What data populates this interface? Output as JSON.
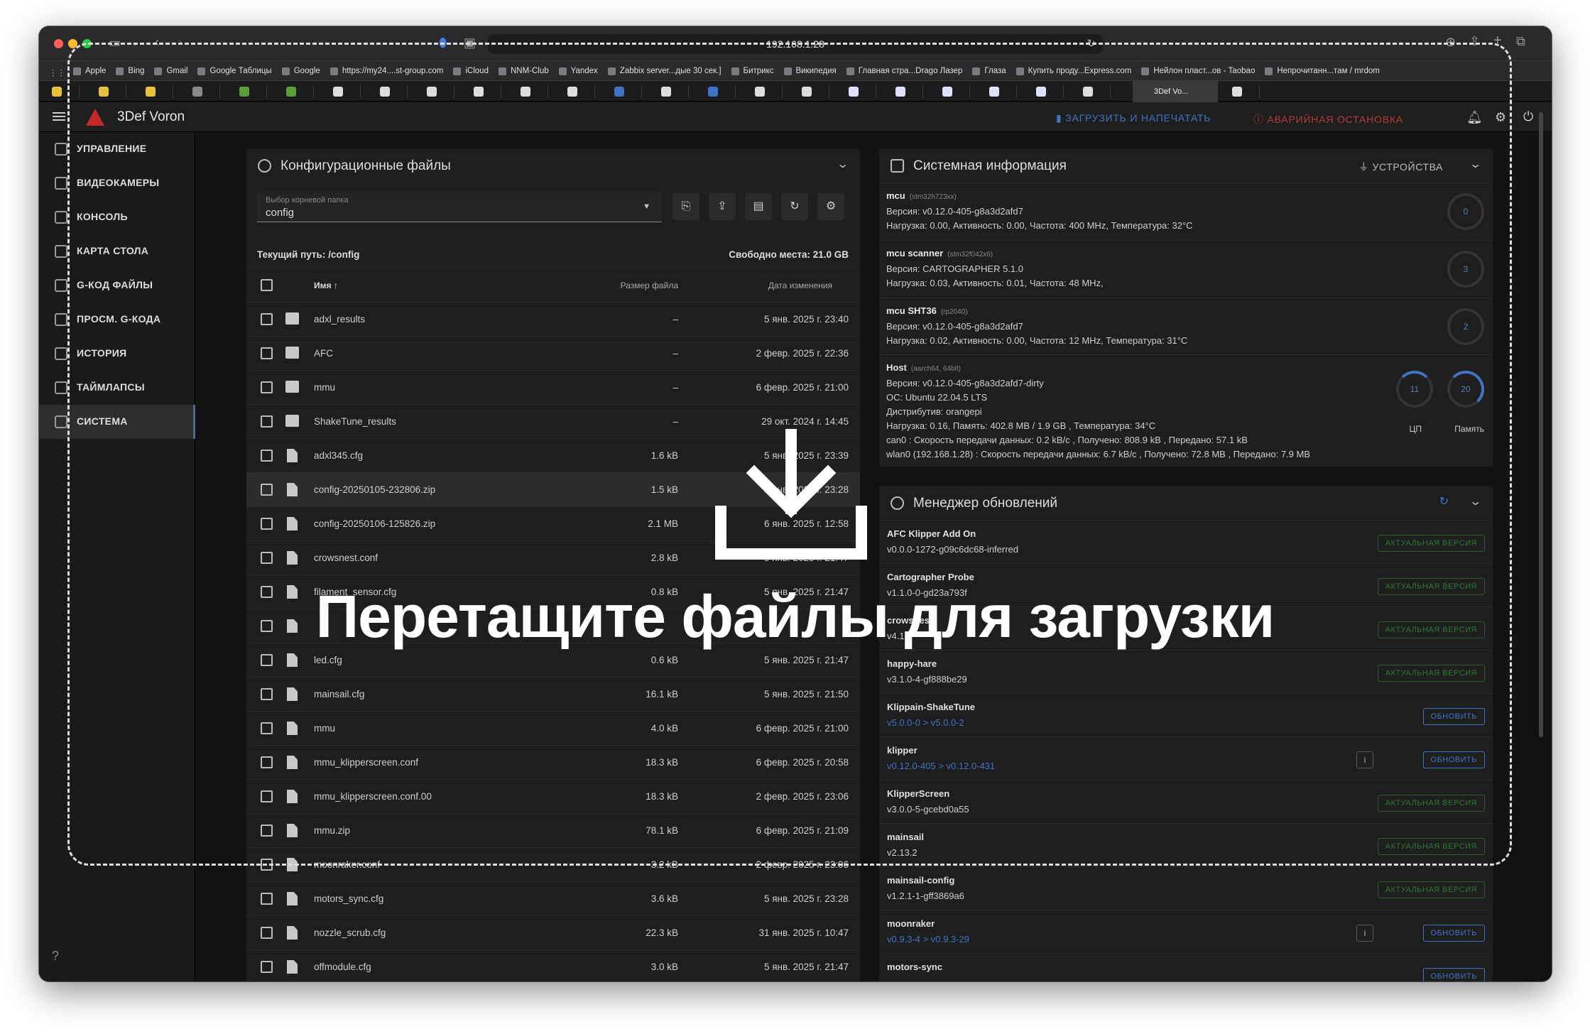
{
  "browser": {
    "url": "192.168.1.28",
    "favorites": [
      "Apple",
      "Bing",
      "Gmail",
      "Google Таблицы",
      "Google",
      "https://my24....st-group.com",
      "iCloud",
      "NNM-Club",
      "Yandex",
      "Zabbix server...дые 30 сек.]",
      "Битрикс",
      "Википедия",
      "Главная стра...Drago Лазер",
      "Глаза",
      "Купить проду...Express.com",
      "Нейлон пласт...ов - Taobao",
      "Непрочитанн...там / mrdom"
    ],
    "active_tab": "3Def Vo..."
  },
  "app": {
    "title": "3Def Voron",
    "upload_print": "ЗАГРУЗИТЬ И НАПЕЧАТАТЬ",
    "emergency_stop": "АВАРИЙНАЯ ОСТАНОВКА"
  },
  "sidebar": {
    "items": [
      {
        "label": "УПРАВЛЕНИЕ"
      },
      {
        "label": "ВИДЕОКАМЕРЫ"
      },
      {
        "label": "КОНСОЛЬ"
      },
      {
        "label": "КАРТА СТОЛА"
      },
      {
        "label": "G-КОД ФАЙЛЫ"
      },
      {
        "label": "ПРОСМ. G-КОДА"
      },
      {
        "label": "ИСТОРИЯ"
      },
      {
        "label": "ТАЙМЛАПСЫ"
      },
      {
        "label": "СИСТЕМА"
      }
    ]
  },
  "config": {
    "title": "Конфигурационные файлы",
    "root_label": "Выбор корневой папка",
    "root_value": "config",
    "path_label": "Текущий путь: /config",
    "free_label": "Свободно места: 21.0 GB",
    "col_name": "Имя",
    "col_size": "Размер файла",
    "col_date": "Дата изменения",
    "files": [
      {
        "name": "adxl_results",
        "size": "–",
        "date": "5 янв. 2025 г. 23:40",
        "type": "folder"
      },
      {
        "name": "AFC",
        "size": "–",
        "date": "2 февр. 2025 г. 22:36",
        "type": "folder"
      },
      {
        "name": "mmu",
        "size": "–",
        "date": "6 февр. 2025 г. 21:00",
        "type": "folder"
      },
      {
        "name": "ShakeTune_results",
        "size": "–",
        "date": "29 окт. 2024 г. 14:45",
        "type": "folder"
      },
      {
        "name": "adxl345.cfg",
        "size": "1.6 kB",
        "date": "5 янв. 2025 г. 23:39",
        "type": "file"
      },
      {
        "name": "config-20250105-232806.zip",
        "size": "1.5 kB",
        "date": "5 янв. 2025 г. 23:28",
        "type": "file"
      },
      {
        "name": "config-20250106-125826.zip",
        "size": "2.1 MB",
        "date": "6 янв. 2025 г. 12:58",
        "type": "file"
      },
      {
        "name": "crowsnest.conf",
        "size": "2.8 kB",
        "date": "5 янв. 2025 г. 21:47",
        "type": "file"
      },
      {
        "name": "filament_sensor.cfg",
        "size": "0.8 kB",
        "date": "5 янв. 2025 г. 21:47",
        "type": "file"
      },
      {
        "name": "",
        "size": "",
        "date": "",
        "type": "file"
      },
      {
        "name": "led.cfg",
        "size": "0.6 kB",
        "date": "5 янв. 2025 г. 21:47",
        "type": "file"
      },
      {
        "name": "mainsail.cfg",
        "size": "16.1 kB",
        "date": "5 янв. 2025 г. 21:50",
        "type": "file"
      },
      {
        "name": "mmu",
        "size": "4.0 kB",
        "date": "6 февр. 2025 г. 21:00",
        "type": "file"
      },
      {
        "name": "mmu_klipperscreen.conf",
        "size": "18.3 kB",
        "date": "6 февр. 2025 г. 20:58",
        "type": "file"
      },
      {
        "name": "mmu_klipperscreen.conf.00",
        "size": "18.3 kB",
        "date": "2 февр. 2025 г. 23:06",
        "type": "file"
      },
      {
        "name": "mmu.zip",
        "size": "78.1 kB",
        "date": "6 февр. 2025 г. 21:09",
        "type": "file"
      },
      {
        "name": "moonraker.conf",
        "size": "3.2 kB",
        "date": "2 февр. 2025 г. 23:06",
        "type": "file"
      },
      {
        "name": "motors_sync.cfg",
        "size": "3.6 kB",
        "date": "5 янв. 2025 г. 23:28",
        "type": "file"
      },
      {
        "name": "nozzle_scrub.cfg",
        "size": "22.3 kB",
        "date": "31 янв. 2025 г. 10:47",
        "type": "file"
      },
      {
        "name": "offmodule.cfg",
        "size": "3.0 kB",
        "date": "5 янв. 2025 г. 21:47",
        "type": "file"
      }
    ]
  },
  "sysinfo": {
    "title": "Системная информация",
    "devices": "УСТРОЙСТВА",
    "mcus": [
      {
        "name": "mcu",
        "chip": "(stm32h723xx)",
        "line1": "Версия: v0.12.0-405-g8a3d2afd7",
        "line2": "Нагрузка: 0.00, Активность: 0.00, Частота: 400 MHz, Температура: 32°C",
        "ring": "0"
      },
      {
        "name": "mcu scanner",
        "chip": "(stm32f042x6)",
        "line1": "Версия: CARTOGRAPHER 5.1.0",
        "line2": "Нагрузка: 0.03, Активность: 0.01, Частота: 48 MHz,",
        "ring": "3"
      },
      {
        "name": "mcu SHT36",
        "chip": "(rp2040)",
        "line1": "Версия: v0.12.0-405-g8a3d2afd7",
        "line2": "Нагрузка: 0.02, Активность: 0.00, Частота: 12 MHz, Температура: 31°C",
        "ring": "2"
      }
    ],
    "host": {
      "name": "Host",
      "chip": "(aarch64, 64bit)",
      "lines": [
        "Версия: v0.12.0-405-g8a3d2afd7-dirty",
        "ОС: Ubuntu 22.04.5 LTS",
        "Дистрибутив: orangepi",
        "Нагрузка: 0.16, Память: 402.8 MB / 1.9 GB , Температура: 34°C",
        "can0 : Скорость передачи данных: 0.2 kB/c , Получено: 808.9 kB , Передано: 57.1 kB",
        "wlan0 (192.168.1.28) : Скорость передачи данных: 6.7 kB/c , Получено: 72.8 MB , Передано: 7.9 MB"
      ],
      "cpu_value": "11",
      "cpu_label": "ЦП",
      "mem_value": "20",
      "mem_label": "Память"
    }
  },
  "updates": {
    "title": "Менеджер обновлений",
    "items": [
      {
        "name": "AFC Klipper Add On",
        "version": "v0.0.0-1272-g09c6dc68-inferred",
        "status": "АКТУАЛЬНАЯ ВЕРСИЯ",
        "update": false
      },
      {
        "name": "Cartographer Probe",
        "version": "v1.1.0-0-gd23a793f",
        "status": "АКТУАЛЬНАЯ ВЕРСИЯ",
        "update": false
      },
      {
        "name": "crowsnest",
        "version": "v4.1.",
        "status": "АКТУАЛЬНАЯ ВЕРСИЯ",
        "update": false
      },
      {
        "name": "happy-hare",
        "version": "v3.1.0-4-gf888be29",
        "status": "АКТУАЛЬНАЯ ВЕРСИЯ",
        "update": false
      },
      {
        "name": "Klippain-ShakeTune",
        "version": "v5.0.0-0 > v5.0.0-2",
        "status": "ОБНОВИТЬ",
        "update": true
      },
      {
        "name": "klipper",
        "version": "v0.12.0-405 > v0.12.0-431",
        "status": "ОБНОВИТЬ",
        "update": true,
        "info": true
      },
      {
        "name": "KlipperScreen",
        "version": "v3.0.0-5-gcebd0a55",
        "status": "АКТУАЛЬНАЯ ВЕРСИЯ",
        "update": false
      },
      {
        "name": "mainsail",
        "version": "v2.13.2",
        "status": "АКТУАЛЬНАЯ ВЕРСИЯ",
        "update": false
      },
      {
        "name": "mainsail-config",
        "version": "v1.2.1-1-gff3869a6",
        "status": "АКТУАЛЬНАЯ ВЕРСИЯ",
        "update": false
      },
      {
        "name": "moonraker",
        "version": "v0.9.3-4 > v0.9.3-29",
        "status": "ОБНОВИТЬ",
        "update": true,
        "info": true
      },
      {
        "name": "motors-sync",
        "version": "",
        "status": "ОБНОВИТЬ",
        "update": true
      }
    ]
  },
  "drop": {
    "message": "Перетащите файлы для загрузки"
  }
}
